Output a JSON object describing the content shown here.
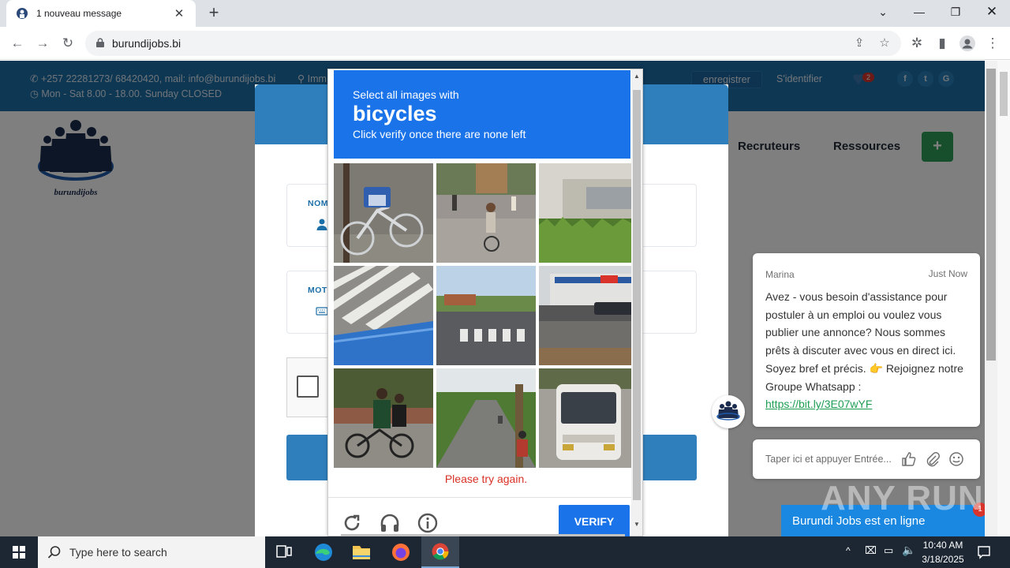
{
  "browser": {
    "tab_title": "1 nouveau message",
    "url": "burundijobs.bi",
    "window_controls": [
      "minimize-icon",
      "restore-icon",
      "close-icon"
    ]
  },
  "site": {
    "contact_line": "+257 22281273/ 68420420, mail: info@burundijobs.bi",
    "hours_line": "Mon - Sat 8.00 - 18.00. Sunday CLOSED",
    "location_prefix": "Imm",
    "register_label": "enregistrer",
    "login_label": "S'identifier",
    "favorites_count": "2",
    "logo_text": "burundijobs",
    "nav": [
      "Recruteurs",
      "Ressources"
    ],
    "nav_plus": "+",
    "form": {
      "name_label": "NOM",
      "password_label": "MOT"
    }
  },
  "captcha": {
    "instruction_top": "Select all images with",
    "target": "bicycles",
    "instruction_bottom": "Click verify once there are none left",
    "error": "Please try again.",
    "verify_label": "VERIFY",
    "tiles": [
      "bicycle-with-child-seat",
      "cyclist-on-street",
      "hedge-and-bus",
      "crosswalk-and-blue-surface",
      "crosswalk-road",
      "storefront-street",
      "cyclists-on-road",
      "motorcyclist-on-road",
      "white-bus"
    ]
  },
  "chat": {
    "agent_name": "Marina",
    "time": "Just Now",
    "message": "Avez - vous besoin d'assistance pour postuler à un emploi ou voulez vous publier une annonce? Nous sommes prêts à discuter avec vous en direct ici. Soyez bref et précis. 👉 Rejoignez notre Groupe Whatsapp :",
    "link": "https://bit.ly/3E07wYF",
    "input_placeholder": "Taper ici et appuyer Entrée...",
    "status_bar": "Burundi Jobs est en ligne",
    "unread": "1"
  },
  "watermark": "ANY RUN",
  "taskbar": {
    "search_placeholder": "Type here to search",
    "time": "10:40 AM",
    "date": "3/18/2025"
  }
}
